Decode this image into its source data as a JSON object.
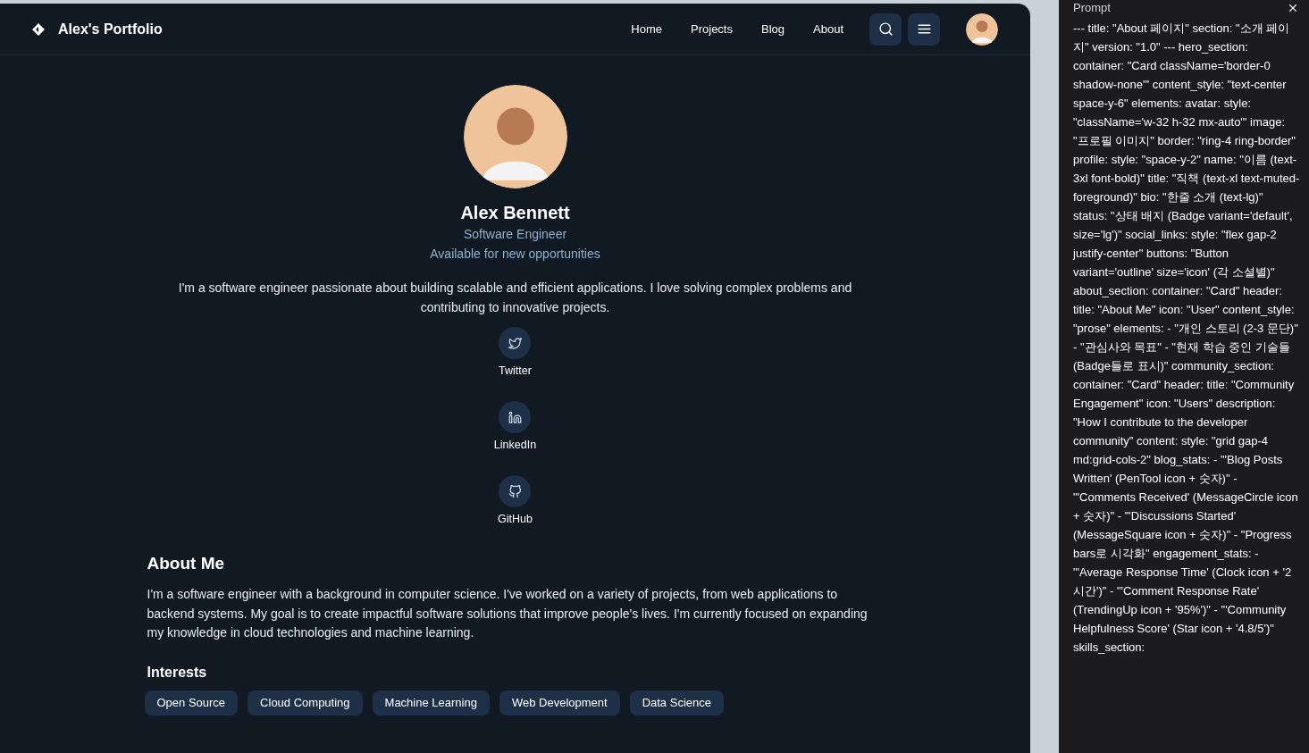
{
  "nav": {
    "brand": "Alex's Portfolio",
    "links": [
      "Home",
      "Projects",
      "Blog",
      "About"
    ]
  },
  "hero": {
    "name": "Alex Bennett",
    "title": "Software Engineer",
    "status": "Available for new opportunities",
    "bio": "I'm a software engineer passionate about building scalable and efficient applications. I love solving complex problems and contributing to innovative projects.",
    "social_links": [
      {
        "label": "Twitter",
        "kind": "twitter"
      },
      {
        "label": "LinkedIn",
        "kind": "linkedin"
      },
      {
        "label": "GitHub",
        "kind": "github"
      }
    ]
  },
  "about": {
    "heading": "About Me",
    "paragraph": "I'm a software engineer with a background in computer science. I've worked on a variety of projects, from web applications to backend systems. My goal is to create impactful software solutions that improve people's lives. I'm currently focused on expanding my knowledge in cloud technologies and machine learning.",
    "interests_heading": "Interests",
    "interests": [
      "Open Source",
      "Cloud Computing",
      "Machine Learning",
      "Web Development",
      "Data Science"
    ]
  },
  "prompt_panel": {
    "title": "Prompt",
    "text": "--- title: \"About 페이지\" section: \"소개 페이지\" version: \"1.0\" --- hero_section: container: \"Card className='border-0 shadow-none'\" content_style: \"text-center space-y-6\" elements: avatar: style: \"className='w-32 h-32 mx-auto'\" image: \"프로필 이미지\" border: \"ring-4 ring-border\" profile: style: \"space-y-2\" name: \"이름 (text-3xl font-bold)\" title: \"직책 (text-xl text-muted-foreground)\" bio: \"한줄 소개 (text-lg)\" status: \"상태 배지 (Badge variant='default', size='lg')\" social_links: style: \"flex gap-2 justify-center\" buttons: \"Button variant='outline' size='icon' (각 소셜별)\" about_section: container: \"Card\" header: title: \"About Me\" icon: \"User\" content_style: \"prose\" elements: - \"개인 스토리 (2-3 문단)\" - \"관심사와 목표\" - \"현재 학습 중인 기술들 (Badge들로 표시)\" community_section: container: \"Card\" header: title: \"Community Engagement\" icon: \"Users\" description: \"How I contribute to the developer community\" content: style: \"grid gap-4 md:grid-cols-2\" blog_stats: - \"'Blog Posts Written' (PenTool icon + 숫자)\" - \"'Comments Received' (MessageCircle icon + 숫자)\" - \"'Discussions Started' (MessageSquare icon + 숫자)\" - \"Progress bars로 시각화\" engagement_stats: - \"'Average Response Time' (Clock icon + '2시간')\" - \"'Comment Response Rate' (TrendingUp icon + '95%')\" - \"'Community Helpfulness Score' (Star icon + '4.8/5')\" skills_section:"
  }
}
